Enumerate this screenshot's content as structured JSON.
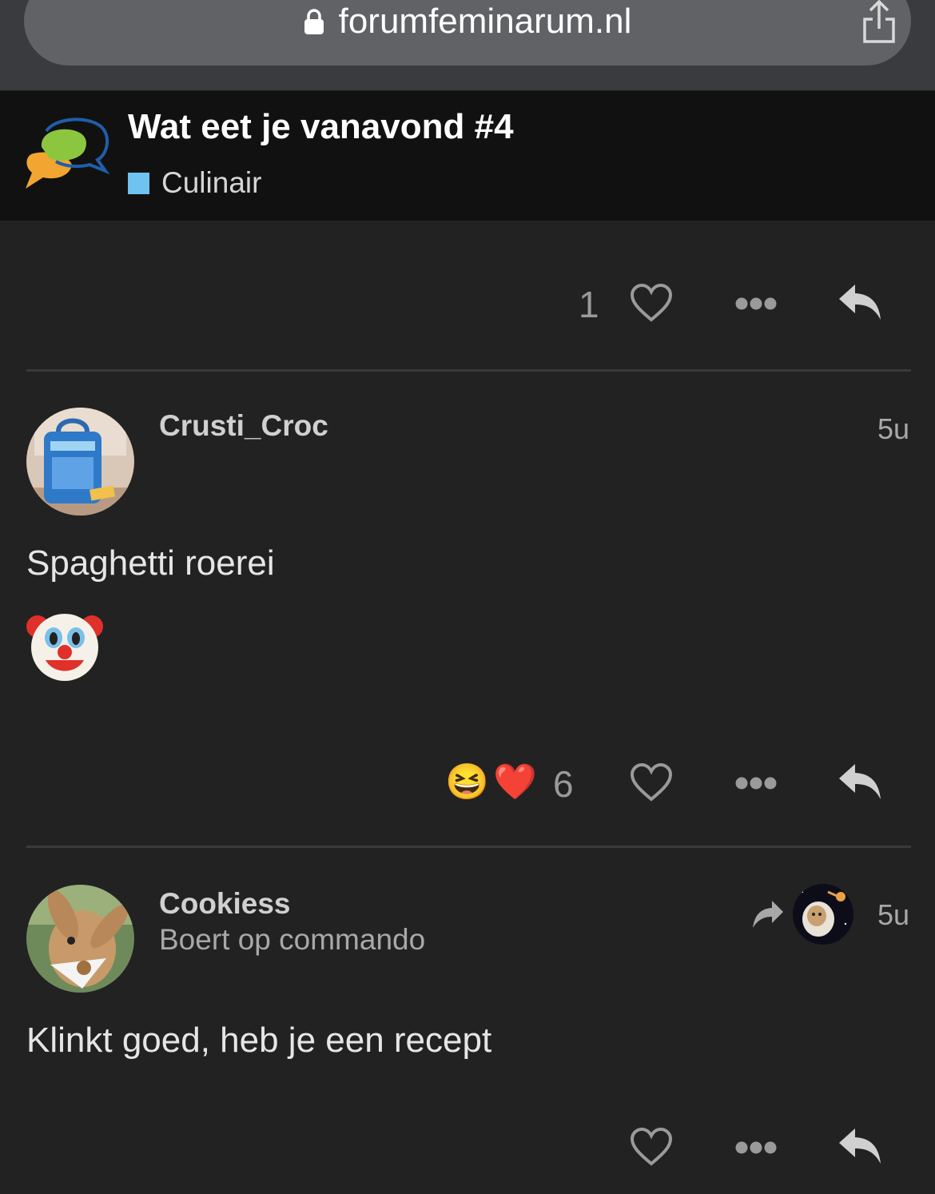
{
  "browser": {
    "url": "forumfeminarum.nl"
  },
  "topic": {
    "title": "Wat eet je vanavond #4",
    "category": "Culinair",
    "category_color": "#6fc3f0"
  },
  "first_actions": {
    "like_count": "1"
  },
  "posts": [
    {
      "username": "Crusti_Croc",
      "time": "5u",
      "text": "Spaghetti roerei",
      "emoji": "clown-face",
      "reactions": [
        "😆",
        "❤️"
      ],
      "like_count": "6"
    },
    {
      "username": "Cookiess",
      "user_title": "Boert op commando",
      "time": "5u",
      "text": "Klinkt goed, heb je een recept"
    }
  ]
}
